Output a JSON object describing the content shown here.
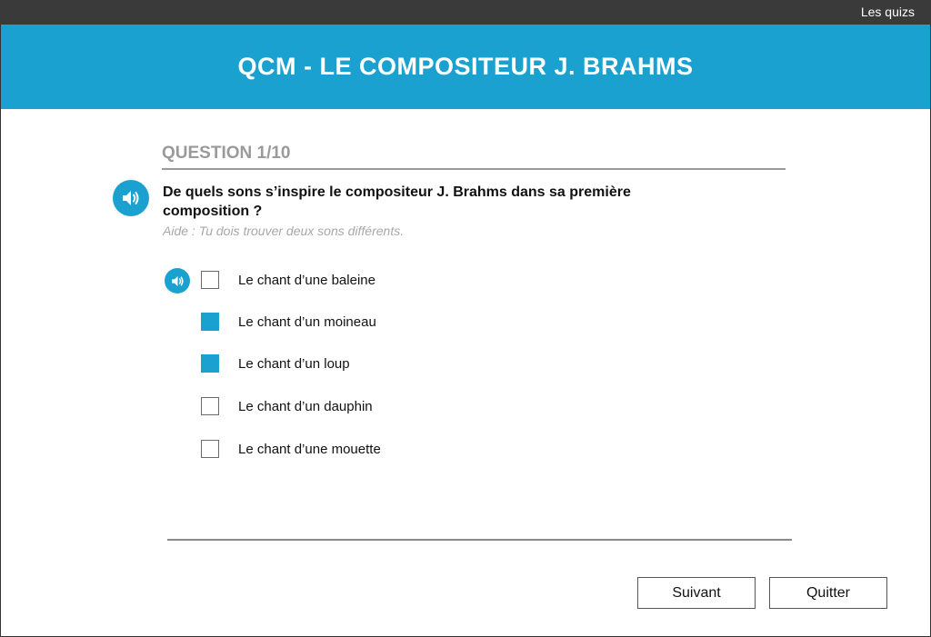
{
  "topbar": {
    "app_link": "Les quizs"
  },
  "header": {
    "title": "QCM - LE COMPOSITEUR J. BRAHMS"
  },
  "question": {
    "number_label": "QUESTION 1/10",
    "text": "De quels sons s’inspire le compositeur J. Brahms dans sa première composition ?",
    "hint": "Aide : Tu dois trouver deux sons différents."
  },
  "options": [
    {
      "label": "Le chant d’une baleine",
      "checked": false
    },
    {
      "label": "Le chant d’un moineau",
      "checked": true
    },
    {
      "label": "Le chant d’un loup",
      "checked": true
    },
    {
      "label": "Le chant d’un dauphin",
      "checked": false
    },
    {
      "label": "Le chant d’une mouette",
      "checked": false
    }
  ],
  "buttons": {
    "next_label": "Suivant",
    "quit_label": "Quitter"
  },
  "colors": {
    "accent": "#1ba1cf",
    "topbar": "#3a3a3a",
    "muted_text": "#9a9a9a"
  },
  "icons": {
    "audio": "speaker-icon"
  }
}
